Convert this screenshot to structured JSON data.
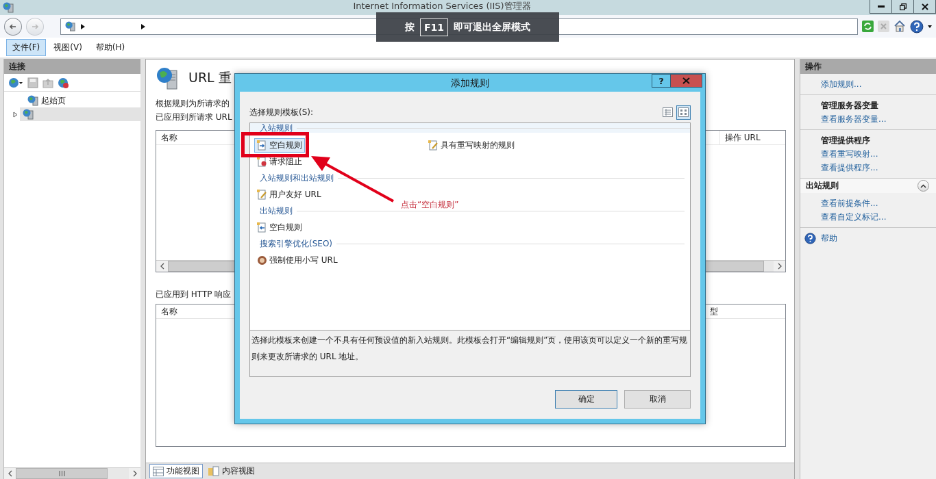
{
  "window": {
    "title": "Internet Information Services (IIS)管理器"
  },
  "menu": [
    {
      "label": "文件(F)",
      "selected": true
    },
    {
      "label": "视图(V)",
      "selected": false
    },
    {
      "label": "帮助(H)",
      "selected": false
    }
  ],
  "connections": {
    "title": "连接",
    "tree": [
      {
        "label": "起始页",
        "selected": false
      },
      {
        "selected": true,
        "expanded": false
      }
    ]
  },
  "feature": {
    "title": "URL 重",
    "description": "根据规则为所请求的",
    "inbound": {
      "caption": "已应用到所请求 URL",
      "columns": [
        "名称",
        "操作 URL"
      ]
    },
    "outbound": {
      "caption": "已应用到 HTTP 响应",
      "columns": [
        "名称",
        "型"
      ]
    }
  },
  "view_tabs": [
    {
      "label": "功能视图",
      "selected": true
    },
    {
      "label": "内容视图",
      "selected": false
    }
  ],
  "actions": {
    "title": "操作",
    "groups": [
      {
        "items": [
          {
            "label": "添加规则...",
            "kind": "link"
          }
        ]
      },
      {
        "heading": "管理服务器变量",
        "items": [
          {
            "label": "查看服务器变量...",
            "kind": "link"
          }
        ]
      },
      {
        "heading": "管理提供程序",
        "items": [
          {
            "label": "查看重写映射...",
            "kind": "link"
          },
          {
            "label": "查看提供程序...",
            "kind": "link"
          }
        ]
      },
      {
        "section": "出站规则",
        "expanded": true,
        "items": [
          {
            "label": "查看前提条件...",
            "kind": "link"
          },
          {
            "label": "查看自定义标记...",
            "kind": "link"
          }
        ]
      },
      {
        "items": [
          {
            "label": "帮助",
            "kind": "help"
          }
        ]
      }
    ]
  },
  "dialog": {
    "title": "添加规则",
    "help_button": "?",
    "template_label": "选择规则模板(S):",
    "view_modes": [
      {
        "selected": false
      },
      {
        "selected": true
      }
    ],
    "categories": [
      {
        "heading": "入站规则",
        "items": [
          {
            "label": "空白规则",
            "selected": true
          },
          {
            "label": "具有重写映射的规则",
            "selected": false
          },
          {
            "label": "请求阻止",
            "selected": false
          }
        ]
      },
      {
        "heading": "入站规则和出站规则",
        "items": [
          {
            "label": "用户友好 URL",
            "selected": false
          }
        ]
      },
      {
        "heading": "出站规则",
        "items": [
          {
            "label": "空白规则",
            "selected": false
          }
        ]
      },
      {
        "heading": "搜索引擎优化(SEO)",
        "items": [
          {
            "label": "强制使用小写 URL",
            "selected": false
          }
        ]
      }
    ],
    "description": "选择此模板来创建一个不具有任何预设值的新入站规则。此模板会打开“编辑规则”页，使用该页可以定义一个新的重写规则来更改所请求的 URL 地址。",
    "buttons": [
      {
        "label": "确定",
        "default": true
      },
      {
        "label": "取消",
        "default": false
      }
    ]
  },
  "annotation": {
    "text": "点击“空白规则”"
  },
  "fullscreen_hint": {
    "before": "按",
    "key": "F11",
    "after": "即可退出全屏模式"
  }
}
